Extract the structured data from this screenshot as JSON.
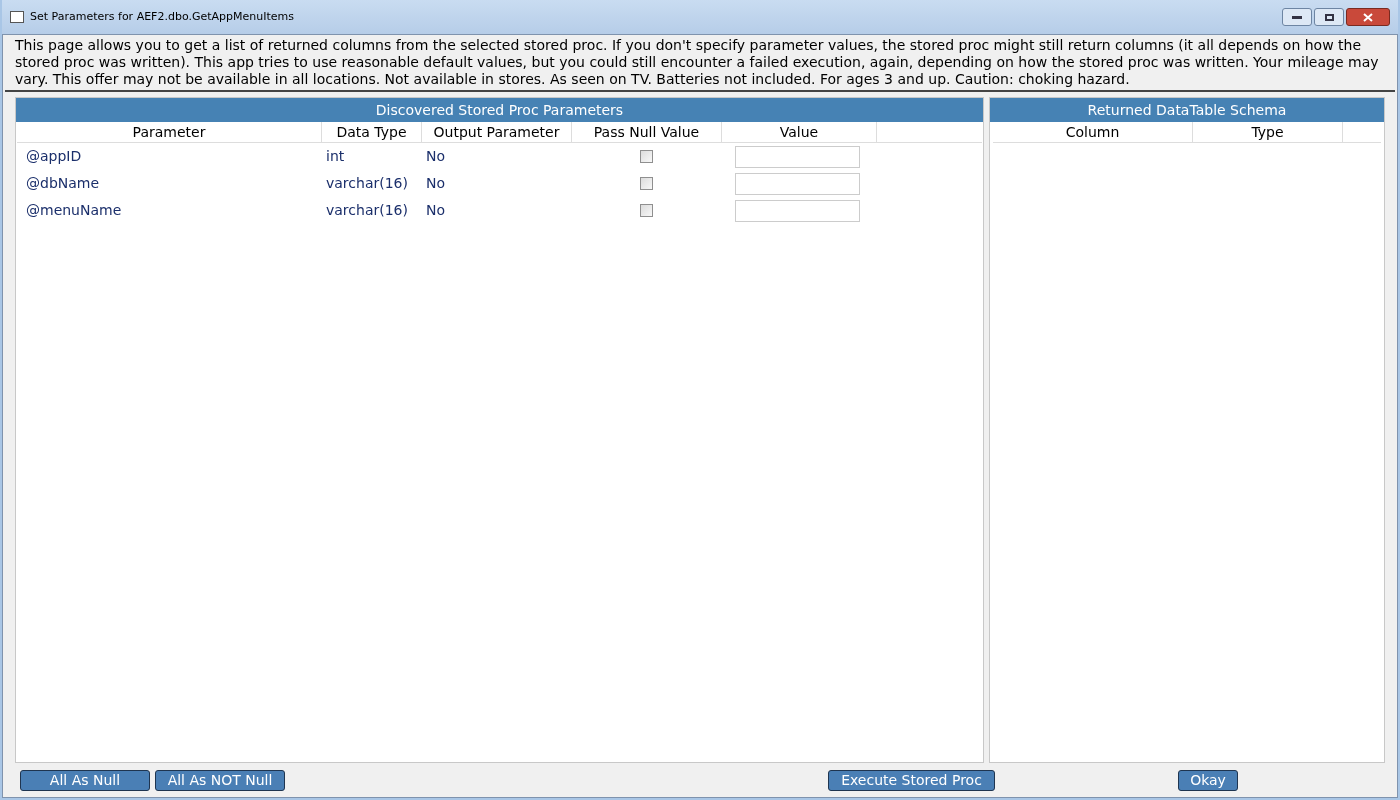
{
  "window": {
    "title": "Set Parameters for AEF2.dbo.GetAppMenuItems"
  },
  "description": "This page allows you to get a list of returned columns from the selected stored proc. If you don't specify parameter values, the stored proc might still return columns (it all depends on how the stored proc was written). This app tries to use reasonable default values, but you could still encounter a failed execution, again, depending on how the stored proc was written. Your mileage may vary. This offer may not be available in all locations. Not available in stores. As seen on TV. Batteries not included. For ages 3 and up. Caution: choking hazard.",
  "parameters_panel": {
    "title": "Discovered Stored Proc Parameters",
    "columns": [
      "Parameter",
      "Data Type",
      "Output Parameter",
      "Pass Null Value",
      "Value"
    ],
    "rows": [
      {
        "parameter": "@appID",
        "data_type": "int",
        "output": "No",
        "pass_null": false
      },
      {
        "parameter": "@dbName",
        "data_type": "varchar(16)",
        "output": "No",
        "pass_null": false
      },
      {
        "parameter": "@menuName",
        "data_type": "varchar(16)",
        "output": "No",
        "pass_null": false
      }
    ]
  },
  "schema_panel": {
    "title": "Returned DataTable Schema",
    "columns": [
      "Column",
      "Type"
    ]
  },
  "buttons": {
    "all_null": "All As Null",
    "all_not_null": "All As NOT Null",
    "execute": "Execute Stored Proc",
    "okay": "Okay"
  }
}
